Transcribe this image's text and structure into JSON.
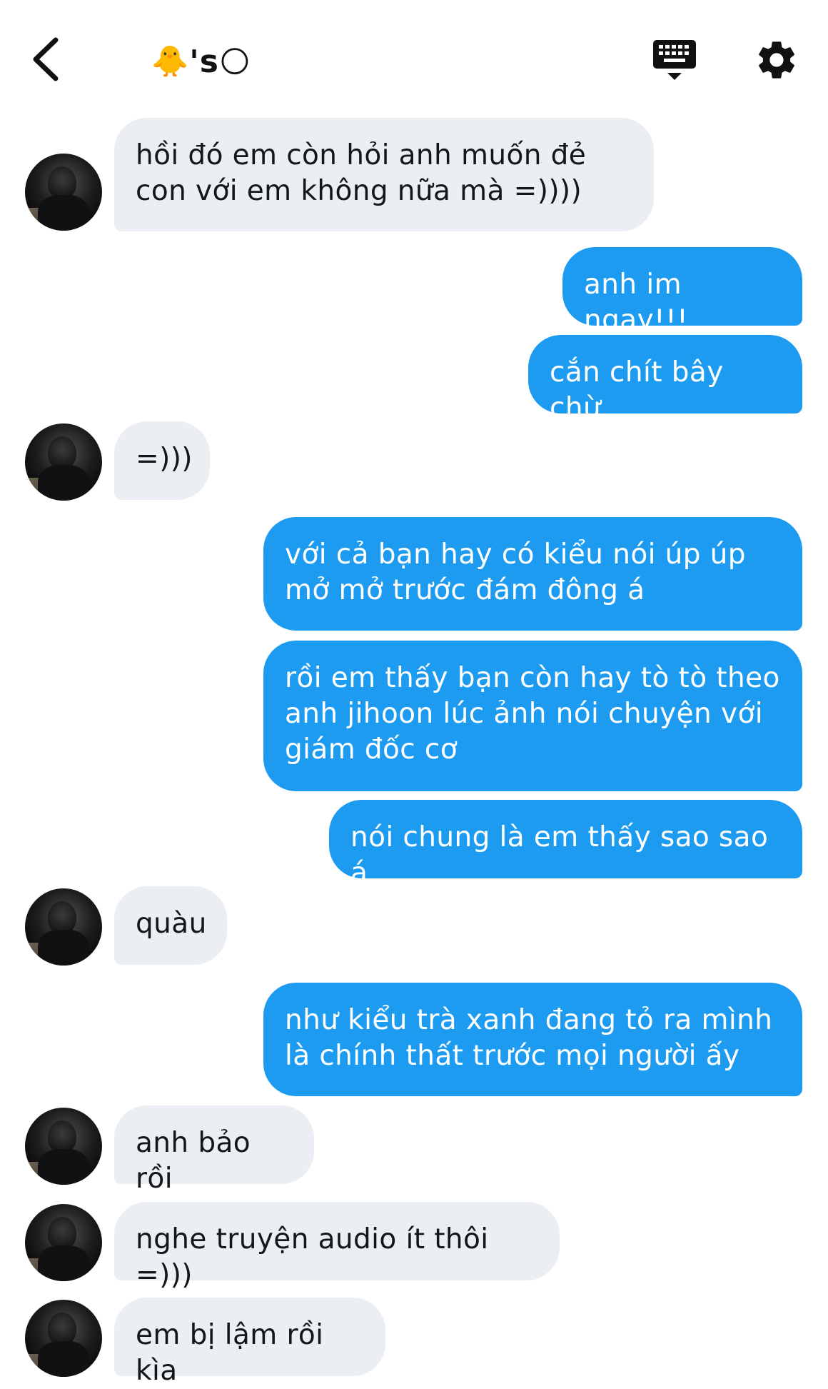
{
  "header": {
    "title_emoji_left": "🐥",
    "title_text": "'s",
    "title_emoji_right": "🌕"
  },
  "icons": {
    "back": "chevron-left-icon",
    "keyboard": "keyboard-icon",
    "settings": "gear-icon"
  },
  "colors": {
    "sent_bubble": "#1d9bf0",
    "received_bubble": "#ebeef2"
  },
  "messages": [
    {
      "direction": "received",
      "text": "hồi đó em còn hỏi anh muốn đẻ\ncon với em không nữa mà =))))"
    },
    {
      "direction": "sent",
      "text": "anh im ngay!!!"
    },
    {
      "direction": "sent",
      "text": "cắn chít bây chừ"
    },
    {
      "direction": "received",
      "text": "=)))"
    },
    {
      "direction": "sent",
      "text": "với cả bạn hay có kiểu nói úp úp\nmở mở trước đám đông á"
    },
    {
      "direction": "sent",
      "text": "rồi em thấy bạn còn hay tò tò theo\nanh jihoon lúc ảnh nói chuyện với\ngiám đốc cơ"
    },
    {
      "direction": "sent",
      "text": "nói chung là em thấy sao sao á"
    },
    {
      "direction": "received",
      "text": "quàu"
    },
    {
      "direction": "sent",
      "text": "như kiểu trà xanh đang tỏ ra mình\nlà chính thất trước mọi người ấy"
    },
    {
      "direction": "received",
      "text": "anh bảo rồi"
    },
    {
      "direction": "received",
      "text": "nghe truyện audio ít thôi =)))"
    },
    {
      "direction": "received",
      "text": "em bị lậm rồi kìa"
    }
  ]
}
